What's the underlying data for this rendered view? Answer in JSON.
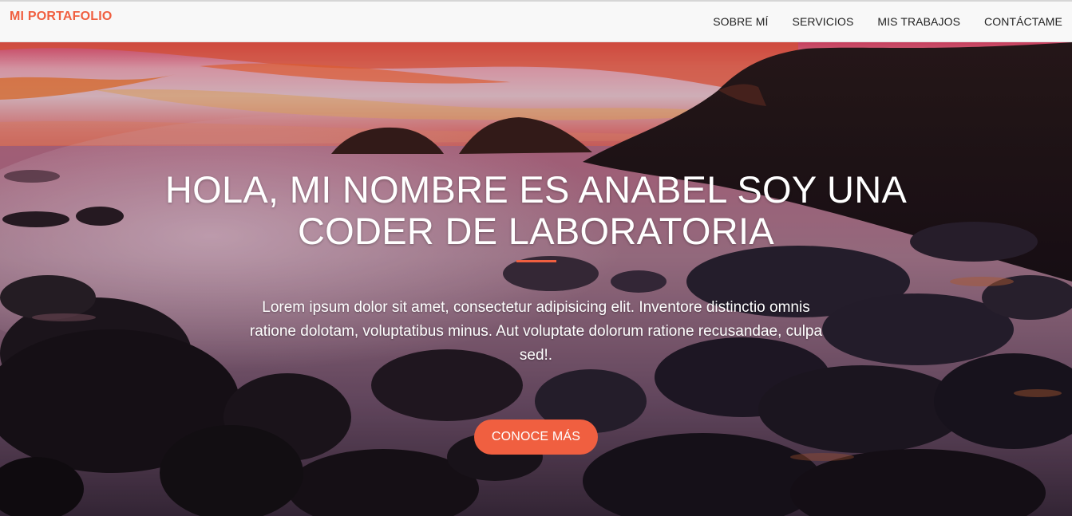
{
  "navbar": {
    "brand": "MI PORTAFOLIO",
    "links": [
      {
        "label": "SOBRE MÍ"
      },
      {
        "label": "SERVICIOS"
      },
      {
        "label": "MIS TRABAJOS"
      },
      {
        "label": "CONTÁCTAME"
      }
    ]
  },
  "hero": {
    "title_line1": "HOLA, MI NOMBRE ES ANABEL SOY UNA",
    "title_line2": "CODER DE LABORATORIA",
    "text": "Lorem ipsum dolor sit amet, consectetur adipisicing elit. Inventore distinctio omnis ratione dolotam, voluptatibus minus. Aut voluptate dolorum ratione recusandae, culpa sed!.",
    "button_label": "CONOCE MÁS"
  },
  "colors": {
    "accent": "#f05f40",
    "navbar_bg": "#f8f8f8",
    "brand": "#f05f40"
  }
}
